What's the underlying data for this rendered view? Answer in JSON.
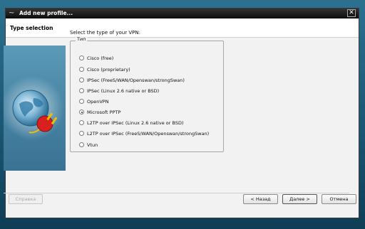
{
  "window": {
    "title": "Add new profile...",
    "close_glyph": "✕"
  },
  "header": {
    "title": "Type selection"
  },
  "main": {
    "prompt": "Select the type of your VPN:",
    "group_label": "Тип",
    "options": [
      {
        "label": "Cisco (free)",
        "selected": false
      },
      {
        "label": "Cisco (proprietary)",
        "selected": false
      },
      {
        "label": "IPSec (FreeS/WAN/Openswan/strongSwan)",
        "selected": false
      },
      {
        "label": "IPSec (Linux 2.6 native or BSD)",
        "selected": false
      },
      {
        "label": "OpenVPN",
        "selected": false
      },
      {
        "label": "Microsoft PPTP",
        "selected": true
      },
      {
        "label": "L2TP over IPSec (Linux 2.6 native or BSD)",
        "selected": false
      },
      {
        "label": "L2TP over IPSec (FreeS/WAN/Openswan/strongSwan)",
        "selected": false
      },
      {
        "label": "Vtun",
        "selected": false
      }
    ]
  },
  "side_image": {
    "icon": "globe-plug-icon"
  },
  "buttons": {
    "help": "Справка",
    "back": "< Назад",
    "next": "Далее >",
    "cancel": "Отмена"
  },
  "colors": {
    "titlebar": "#111111",
    "dialog_bg": "#f2f2f2",
    "desktop": "#1d5a77",
    "plug_red": "#d8201e",
    "plug_yellow": "#f0c000"
  }
}
